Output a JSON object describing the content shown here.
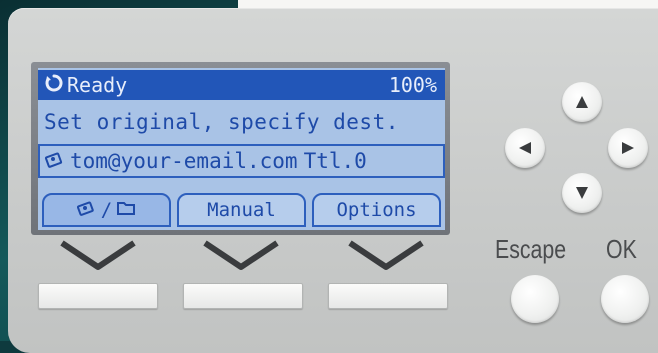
{
  "lcd": {
    "status_text": "Ready",
    "status_value": "100%",
    "message": "Set original, specify dest.",
    "destination_email": "tom@your-email.com",
    "destination_total": "Ttl.0",
    "tabs": [
      {
        "label": "/",
        "icons": [
          "address-book-icon",
          "folder-icon"
        ]
      },
      {
        "label": "Manual"
      },
      {
        "label": "Options"
      }
    ],
    "colors": {
      "screen": "#a9c3e6",
      "status_bar": "#2256b8",
      "text": "#1e4aa8"
    }
  },
  "keys": {
    "escape_label": "Escape",
    "ok_label": "OK"
  }
}
